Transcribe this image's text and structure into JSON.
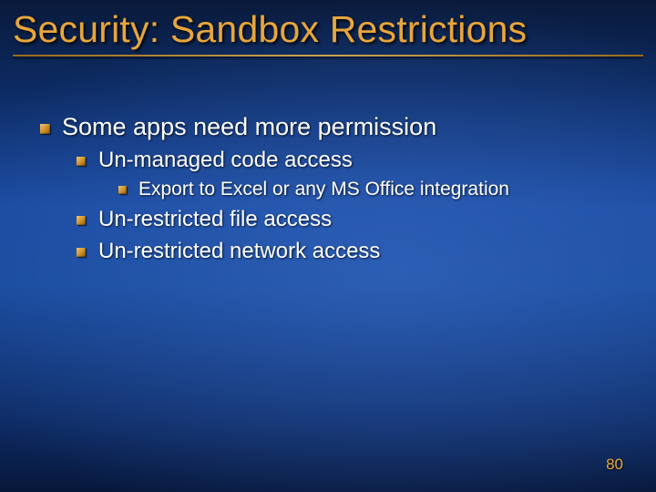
{
  "title": "Security: Sandbox Restrictions",
  "bullets": {
    "l1": "Some apps need more permission",
    "l2_1": "Un-managed code access",
    "l3_1": "Export to Excel or any MS Office integration",
    "l2_2": "Un-restricted file access",
    "l2_3": "Un-restricted network access"
  },
  "page_number": "80"
}
